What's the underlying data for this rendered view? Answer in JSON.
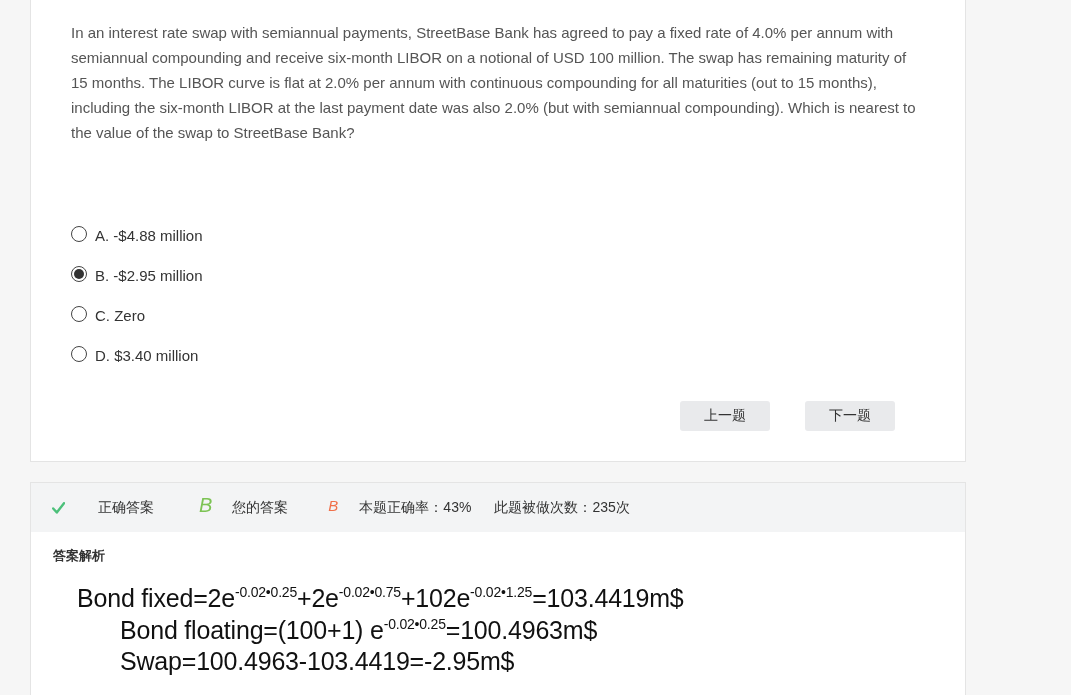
{
  "question": {
    "text": "In an interest rate swap with semiannual payments, StreetBase Bank has agreed to pay a fixed rate of 4.0% per annum with semiannual compounding and receive six-month LIBOR on a notional of USD 100 million. The swap has remaining maturity of 15 months. The LIBOR curve is flat at 2.0% per annum with continuous compounding for all maturities (out to 15 months), including the six-month LIBOR at the last payment date was also 2.0% (but with semiannual compounding). Which is nearest to the value of the swap to StreetBase Bank?"
  },
  "options": [
    {
      "label": "A. -$4.88 million",
      "selected": false
    },
    {
      "label": "B. -$2.95 million",
      "selected": true
    },
    {
      "label": "C. Zero",
      "selected": false
    },
    {
      "label": "D. $3.40 million",
      "selected": false
    }
  ],
  "nav_buttons": [
    "上一题",
    "下一题"
  ],
  "result_bar": {
    "items": [
      {
        "kind": "label",
        "text": "正确答案"
      },
      {
        "kind": "letter",
        "text": "B",
        "color": "#7cc354"
      },
      {
        "kind": "label",
        "text": "您的答案"
      },
      {
        "kind": "letter",
        "text": "B",
        "color": "#f0704a"
      },
      {
        "kind": "stat",
        "text": "本题正确率：43%"
      },
      {
        "kind": "stat",
        "text": "此题被做次数：235次"
      }
    ]
  },
  "explanation": {
    "title": "答案解析",
    "lines": [
      {
        "text": "Bond fixed=2e$^{-0.02•0.25}$+2e$^{-0.02•0.75}$+102e$^{-0.02•1.25}$=103.4419m$",
        "indented": false
      },
      {
        "text": "Bond floating=(100+1) e$^{-0.02•0.25}$=100.4963m$",
        "indented": true
      },
      {
        "text": "Swap=100.4963-103.4419=-2.95m$",
        "indented": true
      }
    ]
  }
}
